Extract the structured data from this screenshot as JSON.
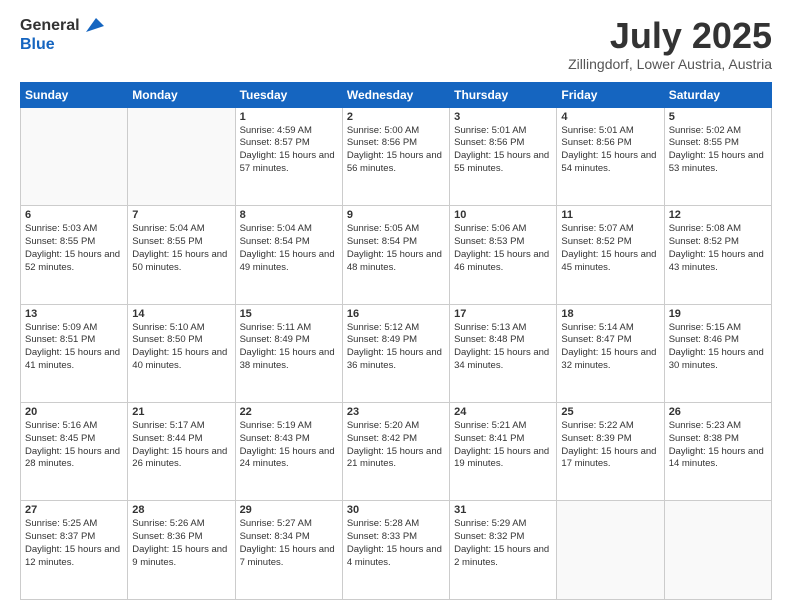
{
  "logo": {
    "general": "General",
    "blue": "Blue"
  },
  "header": {
    "month": "July 2025",
    "location": "Zillingdorf, Lower Austria, Austria"
  },
  "weekdays": [
    "Sunday",
    "Monday",
    "Tuesday",
    "Wednesday",
    "Thursday",
    "Friday",
    "Saturday"
  ],
  "weeks": [
    [
      {
        "day": "",
        "sunrise": "",
        "sunset": "",
        "daylight": ""
      },
      {
        "day": "",
        "sunrise": "",
        "sunset": "",
        "daylight": ""
      },
      {
        "day": "1",
        "sunrise": "Sunrise: 4:59 AM",
        "sunset": "Sunset: 8:57 PM",
        "daylight": "Daylight: 15 hours and 57 minutes."
      },
      {
        "day": "2",
        "sunrise": "Sunrise: 5:00 AM",
        "sunset": "Sunset: 8:56 PM",
        "daylight": "Daylight: 15 hours and 56 minutes."
      },
      {
        "day": "3",
        "sunrise": "Sunrise: 5:01 AM",
        "sunset": "Sunset: 8:56 PM",
        "daylight": "Daylight: 15 hours and 55 minutes."
      },
      {
        "day": "4",
        "sunrise": "Sunrise: 5:01 AM",
        "sunset": "Sunset: 8:56 PM",
        "daylight": "Daylight: 15 hours and 54 minutes."
      },
      {
        "day": "5",
        "sunrise": "Sunrise: 5:02 AM",
        "sunset": "Sunset: 8:55 PM",
        "daylight": "Daylight: 15 hours and 53 minutes."
      }
    ],
    [
      {
        "day": "6",
        "sunrise": "Sunrise: 5:03 AM",
        "sunset": "Sunset: 8:55 PM",
        "daylight": "Daylight: 15 hours and 52 minutes."
      },
      {
        "day": "7",
        "sunrise": "Sunrise: 5:04 AM",
        "sunset": "Sunset: 8:55 PM",
        "daylight": "Daylight: 15 hours and 50 minutes."
      },
      {
        "day": "8",
        "sunrise": "Sunrise: 5:04 AM",
        "sunset": "Sunset: 8:54 PM",
        "daylight": "Daylight: 15 hours and 49 minutes."
      },
      {
        "day": "9",
        "sunrise": "Sunrise: 5:05 AM",
        "sunset": "Sunset: 8:54 PM",
        "daylight": "Daylight: 15 hours and 48 minutes."
      },
      {
        "day": "10",
        "sunrise": "Sunrise: 5:06 AM",
        "sunset": "Sunset: 8:53 PM",
        "daylight": "Daylight: 15 hours and 46 minutes."
      },
      {
        "day": "11",
        "sunrise": "Sunrise: 5:07 AM",
        "sunset": "Sunset: 8:52 PM",
        "daylight": "Daylight: 15 hours and 45 minutes."
      },
      {
        "day": "12",
        "sunrise": "Sunrise: 5:08 AM",
        "sunset": "Sunset: 8:52 PM",
        "daylight": "Daylight: 15 hours and 43 minutes."
      }
    ],
    [
      {
        "day": "13",
        "sunrise": "Sunrise: 5:09 AM",
        "sunset": "Sunset: 8:51 PM",
        "daylight": "Daylight: 15 hours and 41 minutes."
      },
      {
        "day": "14",
        "sunrise": "Sunrise: 5:10 AM",
        "sunset": "Sunset: 8:50 PM",
        "daylight": "Daylight: 15 hours and 40 minutes."
      },
      {
        "day": "15",
        "sunrise": "Sunrise: 5:11 AM",
        "sunset": "Sunset: 8:49 PM",
        "daylight": "Daylight: 15 hours and 38 minutes."
      },
      {
        "day": "16",
        "sunrise": "Sunrise: 5:12 AM",
        "sunset": "Sunset: 8:49 PM",
        "daylight": "Daylight: 15 hours and 36 minutes."
      },
      {
        "day": "17",
        "sunrise": "Sunrise: 5:13 AM",
        "sunset": "Sunset: 8:48 PM",
        "daylight": "Daylight: 15 hours and 34 minutes."
      },
      {
        "day": "18",
        "sunrise": "Sunrise: 5:14 AM",
        "sunset": "Sunset: 8:47 PM",
        "daylight": "Daylight: 15 hours and 32 minutes."
      },
      {
        "day": "19",
        "sunrise": "Sunrise: 5:15 AM",
        "sunset": "Sunset: 8:46 PM",
        "daylight": "Daylight: 15 hours and 30 minutes."
      }
    ],
    [
      {
        "day": "20",
        "sunrise": "Sunrise: 5:16 AM",
        "sunset": "Sunset: 8:45 PM",
        "daylight": "Daylight: 15 hours and 28 minutes."
      },
      {
        "day": "21",
        "sunrise": "Sunrise: 5:17 AM",
        "sunset": "Sunset: 8:44 PM",
        "daylight": "Daylight: 15 hours and 26 minutes."
      },
      {
        "day": "22",
        "sunrise": "Sunrise: 5:19 AM",
        "sunset": "Sunset: 8:43 PM",
        "daylight": "Daylight: 15 hours and 24 minutes."
      },
      {
        "day": "23",
        "sunrise": "Sunrise: 5:20 AM",
        "sunset": "Sunset: 8:42 PM",
        "daylight": "Daylight: 15 hours and 21 minutes."
      },
      {
        "day": "24",
        "sunrise": "Sunrise: 5:21 AM",
        "sunset": "Sunset: 8:41 PM",
        "daylight": "Daylight: 15 hours and 19 minutes."
      },
      {
        "day": "25",
        "sunrise": "Sunrise: 5:22 AM",
        "sunset": "Sunset: 8:39 PM",
        "daylight": "Daylight: 15 hours and 17 minutes."
      },
      {
        "day": "26",
        "sunrise": "Sunrise: 5:23 AM",
        "sunset": "Sunset: 8:38 PM",
        "daylight": "Daylight: 15 hours and 14 minutes."
      }
    ],
    [
      {
        "day": "27",
        "sunrise": "Sunrise: 5:25 AM",
        "sunset": "Sunset: 8:37 PM",
        "daylight": "Daylight: 15 hours and 12 minutes."
      },
      {
        "day": "28",
        "sunrise": "Sunrise: 5:26 AM",
        "sunset": "Sunset: 8:36 PM",
        "daylight": "Daylight: 15 hours and 9 minutes."
      },
      {
        "day": "29",
        "sunrise": "Sunrise: 5:27 AM",
        "sunset": "Sunset: 8:34 PM",
        "daylight": "Daylight: 15 hours and 7 minutes."
      },
      {
        "day": "30",
        "sunrise": "Sunrise: 5:28 AM",
        "sunset": "Sunset: 8:33 PM",
        "daylight": "Daylight: 15 hours and 4 minutes."
      },
      {
        "day": "31",
        "sunrise": "Sunrise: 5:29 AM",
        "sunset": "Sunset: 8:32 PM",
        "daylight": "Daylight: 15 hours and 2 minutes."
      },
      {
        "day": "",
        "sunrise": "",
        "sunset": "",
        "daylight": ""
      },
      {
        "day": "",
        "sunrise": "",
        "sunset": "",
        "daylight": ""
      }
    ]
  ]
}
